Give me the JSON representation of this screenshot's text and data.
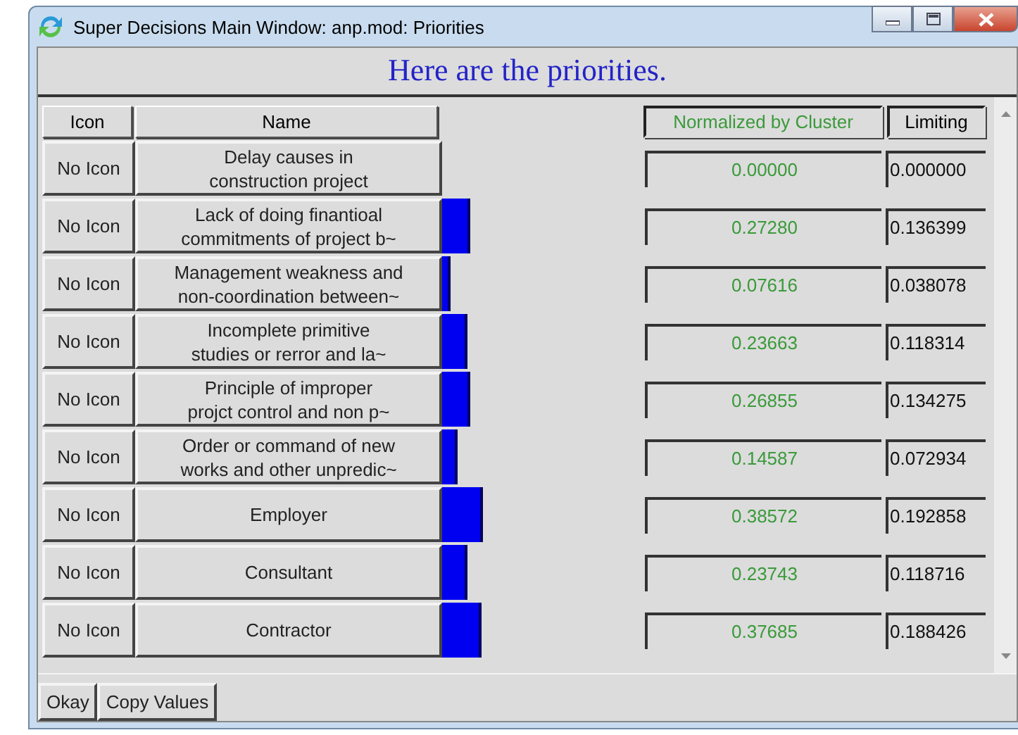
{
  "window": {
    "title": "Super Decisions Main Window: anp.mod: Priorities"
  },
  "heading": "Here are the priorities.",
  "columns": [
    "Icon",
    "Name",
    "Normalized by Cluster",
    "Limiting"
  ],
  "rows": [
    {
      "icon": "No Icon",
      "name_lines": [
        "Delay causes in",
        "construction project"
      ],
      "normalized": "0.00000",
      "limiting": "0.000000"
    },
    {
      "icon": "No Icon",
      "name_lines": [
        "Lack of doing finantioal",
        "commitments of project b~"
      ],
      "normalized": "0.27280",
      "limiting": "0.136399"
    },
    {
      "icon": "No Icon",
      "name_lines": [
        "Management weakness and",
        "non-coordination between~"
      ],
      "normalized": "0.07616",
      "limiting": "0.038078"
    },
    {
      "icon": "No Icon",
      "name_lines": [
        "Incomplete primitive",
        "studies or rerror and la~"
      ],
      "normalized": "0.23663",
      "limiting": "0.118314"
    },
    {
      "icon": "No Icon",
      "name_lines": [
        "Principle of improper",
        "projct control and non p~"
      ],
      "normalized": "0.26855",
      "limiting": "0.134275"
    },
    {
      "icon": "No Icon",
      "name_lines": [
        "Order or command of new",
        "works and other unpredic~"
      ],
      "normalized": "0.14587",
      "limiting": "0.072934"
    },
    {
      "icon": "No Icon",
      "name_lines": [
        "Employer"
      ],
      "normalized": "0.38572",
      "limiting": "0.192858"
    },
    {
      "icon": "No Icon",
      "name_lines": [
        "Consultant"
      ],
      "normalized": "0.23743",
      "limiting": "0.118716"
    },
    {
      "icon": "No Icon",
      "name_lines": [
        "Contractor"
      ],
      "normalized": "0.37685",
      "limiting": "0.188426"
    }
  ],
  "buttons": [
    "Okay",
    "Copy Values"
  ]
}
